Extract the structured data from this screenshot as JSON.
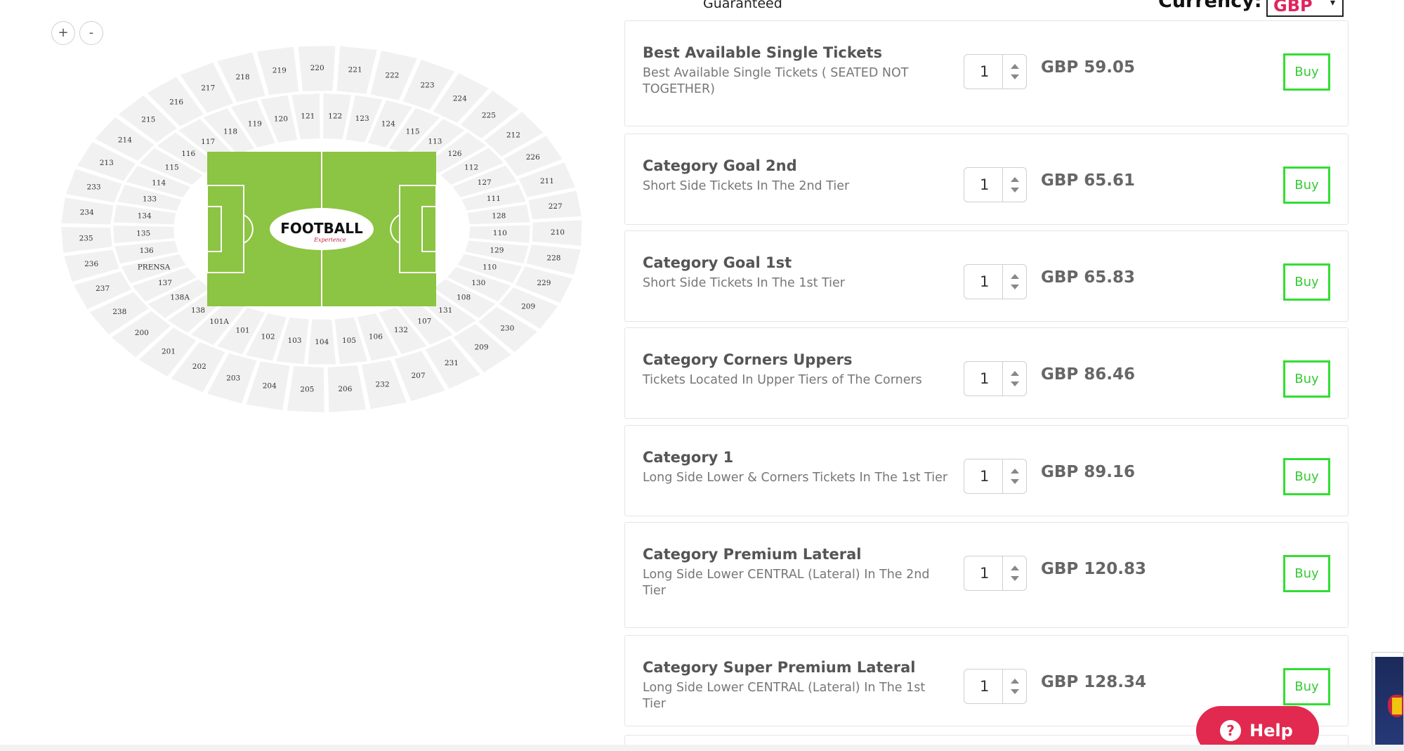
{
  "map": {
    "zoom_in_label": "+",
    "zoom_out_label": "-",
    "logo": {
      "text": "FOOTBALL",
      "subtitle": "Experience"
    },
    "pitch_color": "#8cc443",
    "upper_labels": [
      "213",
      "214",
      "215",
      "216",
      "217",
      "218",
      "219",
      "220",
      "221",
      "222",
      "223",
      "224",
      "225",
      "212",
      "226",
      "211",
      "227",
      "210",
      "228",
      "229",
      "209",
      "230",
      "209",
      "231",
      "207",
      "232",
      "206",
      "205",
      "204",
      "203",
      "202",
      "201",
      "200",
      "238",
      "237",
      "236",
      "235",
      "234",
      "233"
    ],
    "lower_labels": [
      "114",
      "115",
      "116",
      "117",
      "118",
      "119",
      "120",
      "121",
      "122",
      "123",
      "124",
      "115",
      "113",
      "126",
      "112",
      "127",
      "111",
      "128",
      "110",
      "129",
      "110",
      "130",
      "108",
      "131",
      "107",
      "132",
      "106",
      "105",
      "104",
      "103",
      "102",
      "101",
      "101A",
      "138",
      "138A",
      "137",
      "PRENSA",
      "136",
      "135",
      "134",
      "133"
    ]
  },
  "header": {
    "guarantee_text": "Guaranteed",
    "currency_label": "Currency:",
    "currency_value": "GBP"
  },
  "tickets": [
    {
      "title": "Best Available Single Tickets",
      "description": "Best Available Single Tickets ( SEATED NOT TOGETHER)",
      "qty": "1",
      "price": "GBP 59.05",
      "buy_label": "Buy"
    },
    {
      "title": "Category Goal 2nd",
      "description": "Short Side Tickets In The 2nd Tier",
      "qty": "1",
      "price": "GBP 65.61",
      "buy_label": "Buy"
    },
    {
      "title": "Category Goal 1st",
      "description": "Short Side Tickets In The 1st Tier",
      "qty": "1",
      "price": "GBP 65.83",
      "buy_label": "Buy"
    },
    {
      "title": "Category Corners Uppers",
      "description": "Tickets Located In Upper Tiers of The Corners",
      "qty": "1",
      "price": "GBP 86.46",
      "buy_label": "Buy"
    },
    {
      "title": "Category 1",
      "description": "Long Side Lower & Corners Tickets In The 1st Tier",
      "qty": "1",
      "price": "GBP 89.16",
      "buy_label": "Buy"
    },
    {
      "title": "Category Premium Lateral",
      "description": "Long Side Lower CENTRAL (Lateral) In The 2nd Tier",
      "qty": "1",
      "price": "GBP 120.83",
      "buy_label": "Buy"
    },
    {
      "title": "Category Super Premium Lateral",
      "description": "Long Side Lower CENTRAL (Lateral) In The 1st Tier",
      "qty": "1",
      "price": "GBP 128.34",
      "buy_label": "Buy"
    }
  ],
  "help": {
    "label": "Help",
    "icon": "question-icon"
  },
  "colors": {
    "buy_green": "#33dd33",
    "help_red": "#e2294f",
    "currency_pink": "#e0245e"
  }
}
